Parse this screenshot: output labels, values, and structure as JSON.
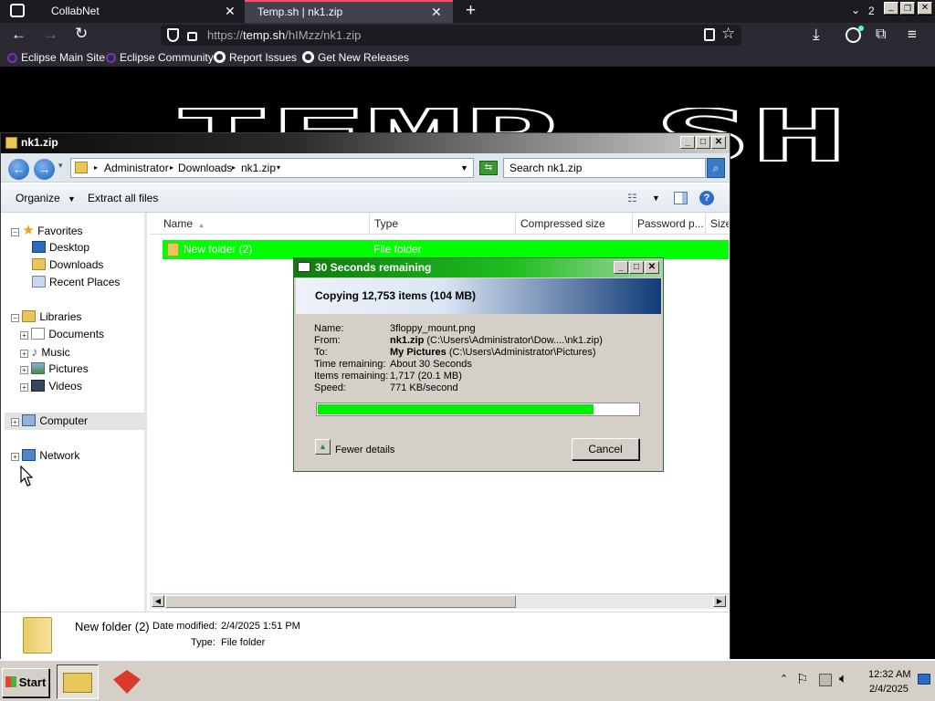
{
  "browser": {
    "tabs": [
      {
        "title": "CollabNet"
      },
      {
        "title": "Temp.sh | nk1.zip"
      }
    ],
    "tab_count_badge": "2",
    "url": "https://temp.sh/hIMzz/nk1.zip",
    "url_prefix": "https://",
    "url_domain": "temp.sh",
    "url_path": "/hIMzz/nk1.zip",
    "bookmarks": [
      {
        "label": "Eclipse Main Site",
        "icon": "eclipse-icon"
      },
      {
        "label": "Eclipse Community",
        "icon": "eclipse-icon"
      },
      {
        "label": "Report Issues",
        "icon": "github-icon"
      },
      {
        "label": "Get New Releases",
        "icon": "github-icon"
      }
    ]
  },
  "page": {
    "banner_text": "TEMP.SH"
  },
  "explorer": {
    "title": "nk1.zip",
    "breadcrumb": [
      "Administrator",
      "Downloads",
      "nk1.zip"
    ],
    "search_placeholder": "Search nk1.zip",
    "toolbar": {
      "organize": "Organize",
      "extract": "Extract all files"
    },
    "nav": {
      "favorites": "Favorites",
      "favorites_items": [
        "Desktop",
        "Downloads",
        "Recent Places"
      ],
      "libraries": "Libraries",
      "libraries_items": [
        "Documents",
        "Music",
        "Pictures",
        "Videos"
      ],
      "computer": "Computer",
      "network": "Network"
    },
    "columns": [
      "Name",
      "Type",
      "Compressed size",
      "Password p...",
      "Size"
    ],
    "rows": [
      {
        "name": "New folder (2)",
        "type": "File folder"
      }
    ],
    "details": {
      "name": "New folder (2)",
      "modified_label": "Date modified:",
      "modified": "2/4/2025 1:51 PM",
      "type_label": "Type:",
      "type": "File folder"
    }
  },
  "copy_dialog": {
    "title": "30 Seconds remaining",
    "header": "Copying 12,753 items (104 MB)",
    "fields": {
      "name_label": "Name:",
      "name": "3floppy_mount.png",
      "from_label": "From:",
      "from_bold": "nk1.zip",
      "from_rest": "(C:\\Users\\Administrator\\Dow....\\nk1.zip)",
      "to_label": "To:",
      "to_bold": "My Pictures",
      "to_rest": "(C:\\Users\\Administrator\\Pictures)",
      "time_label": "Time remaining:",
      "time": "About 30 Seconds",
      "items_label": "Items remaining:",
      "items": "1,717 (20.1 MB)",
      "speed_label": "Speed:",
      "speed": "771 KB/second"
    },
    "progress_fraction": 0.86,
    "fewer_details": "Fewer details",
    "cancel": "Cancel"
  },
  "taskbar": {
    "start": "Start",
    "time": "12:32 AM",
    "date": "2/4/2025"
  },
  "colors": {
    "selection_green": "#00ff00",
    "dialog_title_green": "#1fbf1f",
    "browser_dark": "#2b2a33"
  }
}
